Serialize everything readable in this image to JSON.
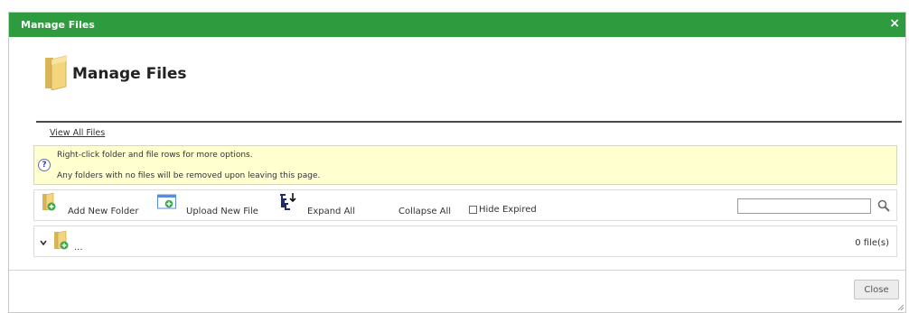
{
  "window": {
    "title": "Manage Files",
    "close_glyph": "×"
  },
  "header": {
    "title": "Manage Files",
    "icon": "folder-icon"
  },
  "links": {
    "view_all": "View All Files"
  },
  "info_box": {
    "icon": "help-icon",
    "line1": "Right-click folder and file rows for more options.",
    "line2": "Any folders with no files will be removed upon leaving this page."
  },
  "toolbar": {
    "add_folder_label": "Add New Folder",
    "upload_label": "Upload New File",
    "expand_label": "Expand All",
    "collapse_label": "Collapse All",
    "hide_expired_label": "Hide Expired",
    "hide_expired_checked": false,
    "search_value": "",
    "search_icon": "magnifier-icon"
  },
  "folder_rows": [
    {
      "name": "...",
      "count": "0 file(s)",
      "expanded": true
    }
  ],
  "footer": {
    "close_label": "Close"
  },
  "colors": {
    "titlebar": "#2e9b3f",
    "info_background": "#ffffcf",
    "folder": "#e7c66b",
    "add_badge": "#3aa845"
  }
}
